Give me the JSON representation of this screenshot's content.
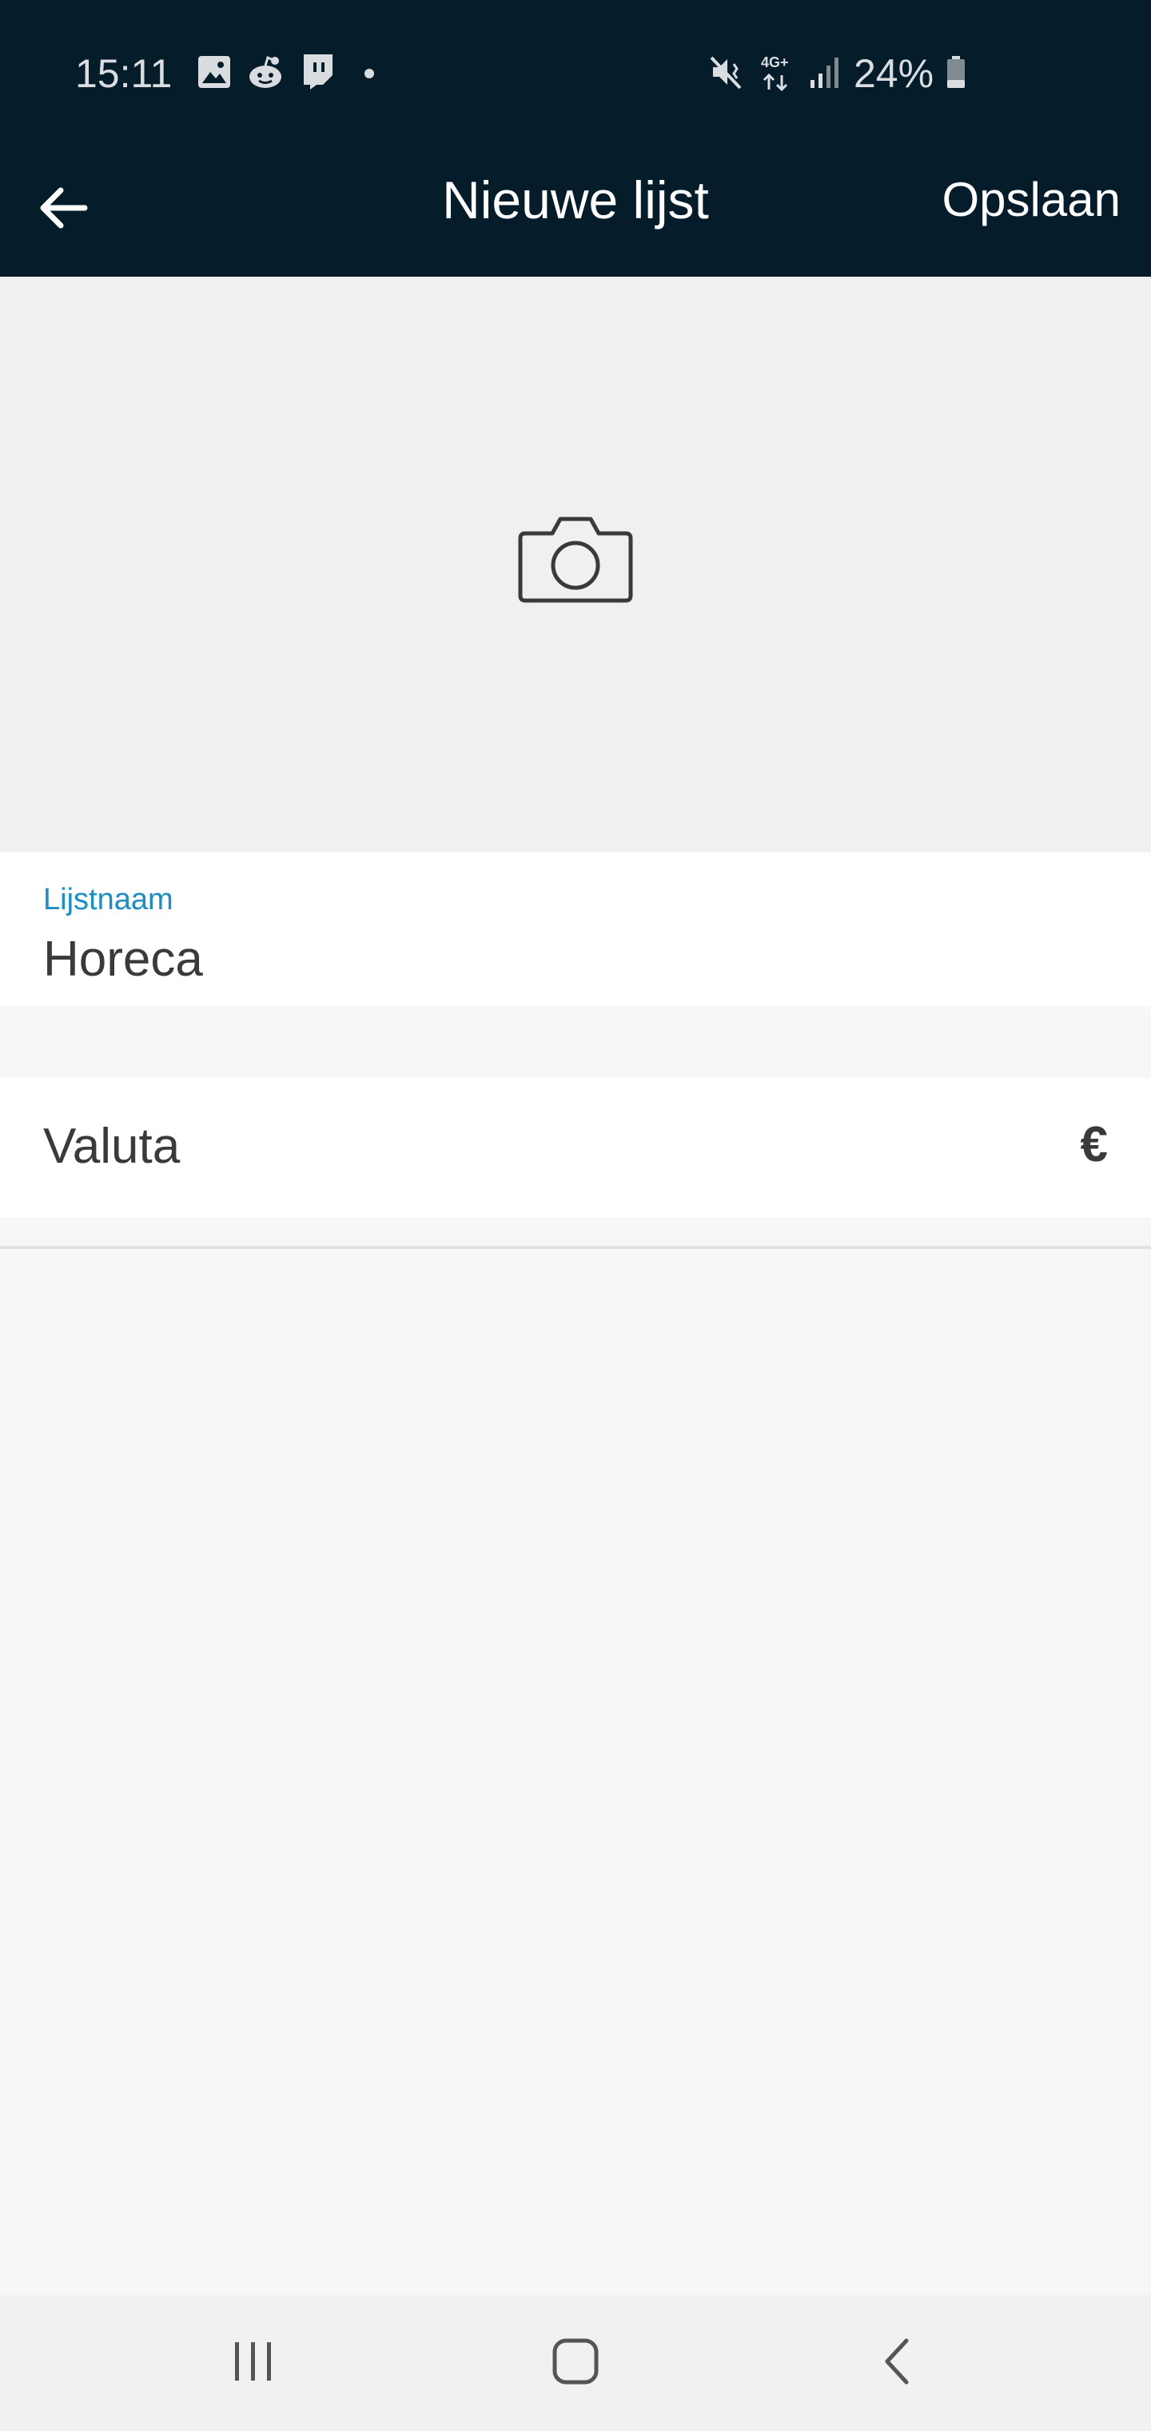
{
  "status_bar": {
    "time": "15:11",
    "battery": "24%",
    "notification_icons": [
      "gallery-icon",
      "reddit-icon",
      "twitch-icon",
      "dot-icon"
    ],
    "system_icons": [
      "mute-vibrate-icon",
      "4g-data-icon",
      "signal-icon",
      "battery-icon"
    ],
    "network_label": "4G+"
  },
  "app_bar": {
    "title": "Nieuwe lijst",
    "save_label": "Opslaan",
    "back_icon": "arrow-left-icon"
  },
  "photo": {
    "icon": "camera-icon"
  },
  "form": {
    "name_label": "Lijstnaam",
    "name_value": "Horeca",
    "currency_label": "Valuta",
    "currency_value": "€"
  },
  "nav_bar": {
    "icons": [
      "recent-apps-icon",
      "home-icon",
      "back-icon"
    ]
  },
  "colors": {
    "app_bar_bg": "#051c2a",
    "accent": "#1a8ec7",
    "page_bg": "#f7f7f7"
  }
}
